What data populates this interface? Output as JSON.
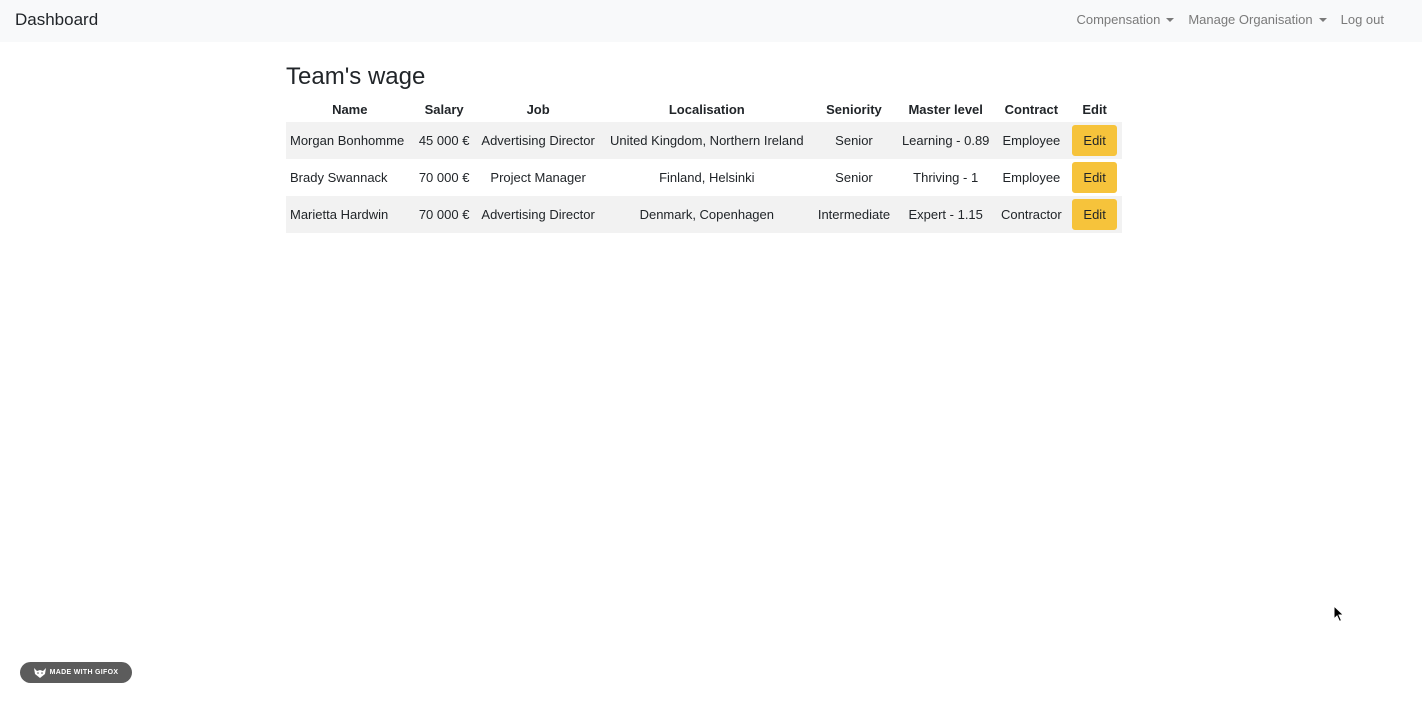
{
  "navbar": {
    "brand": "Dashboard",
    "links": {
      "compensation": "Compensation",
      "manage_organisation": "Manage Organisation",
      "logout": "Log out"
    }
  },
  "page": {
    "title": "Team's wage"
  },
  "table": {
    "headers": {
      "name": "Name",
      "salary": "Salary",
      "job": "Job",
      "localisation": "Localisation",
      "seniority": "Seniority",
      "master_level": "Master level",
      "contract": "Contract",
      "edit": "Edit"
    },
    "rows": [
      {
        "name": "Morgan Bonhomme",
        "salary": "45 000 €",
        "job": "Advertising Director",
        "localisation": "United Kingdom, Northern Ireland",
        "seniority": "Senior",
        "master_level": "Learning - 0.89",
        "contract": "Employee",
        "edit_label": "Edit"
      },
      {
        "name": "Brady Swannack",
        "salary": "70 000 €",
        "job": "Project Manager",
        "localisation": "Finland, Helsinki",
        "seniority": "Senior",
        "master_level": "Thriving - 1",
        "contract": "Employee",
        "edit_label": "Edit"
      },
      {
        "name": "Marietta Hardwin",
        "salary": "70 000 €",
        "job": "Advertising Director",
        "localisation": "Denmark, Copenhagen",
        "seniority": "Intermediate",
        "master_level": "Expert - 1.15",
        "contract": "Contractor",
        "edit_label": "Edit"
      }
    ]
  },
  "badge": {
    "text": "MADE WITH GIFOX",
    "icon": "fox-icon"
  },
  "colors": {
    "navbar_bg": "#f8f9fa",
    "edit_button": "#f6c33b",
    "striped_row": "#f2f2f2"
  }
}
